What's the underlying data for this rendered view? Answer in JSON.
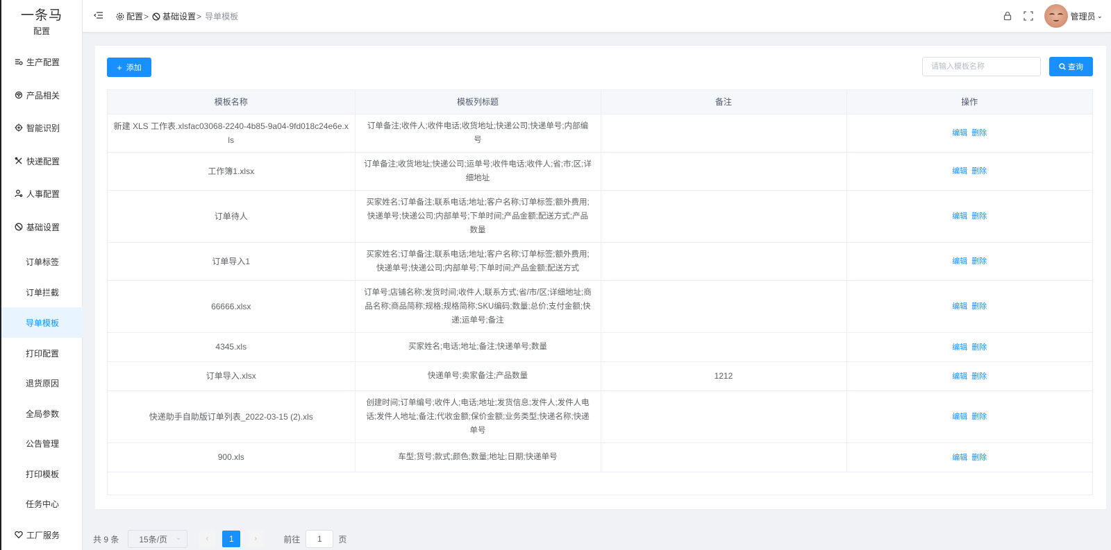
{
  "app": {
    "logo_main": "一条马",
    "logo_sub": "配置"
  },
  "sidebar": {
    "items": [
      {
        "label": "生产配置",
        "icon": "sliders-icon"
      },
      {
        "label": "产品相关",
        "icon": "box-icon"
      },
      {
        "label": "智能识别",
        "icon": "target-icon"
      },
      {
        "label": "快递配置",
        "icon": "tools-icon"
      },
      {
        "label": "人事配置",
        "icon": "user-gear-icon"
      },
      {
        "label": "基础设置",
        "icon": "clock-icon"
      }
    ],
    "sub_items": [
      {
        "label": "订单标签"
      },
      {
        "label": "订单拦截"
      },
      {
        "label": "导单模板"
      },
      {
        "label": "打印配置"
      },
      {
        "label": "退货原因"
      },
      {
        "label": "全局参数"
      },
      {
        "label": "公告管理"
      },
      {
        "label": "打印模板"
      },
      {
        "label": "任务中心"
      }
    ],
    "active_sub": "导单模板",
    "factory": {
      "label": "工厂服务",
      "icon": "heart-icon"
    }
  },
  "header": {
    "breadcrumb": [
      "配置",
      "基础设置",
      "导单模板"
    ],
    "separator": ">",
    "username": "管理员"
  },
  "toolbar": {
    "add_label": "添加",
    "search_placeholder": "请输入模板名称",
    "query_label": "查询"
  },
  "table": {
    "columns": [
      "模板名称",
      "模板列标题",
      "备注",
      "操作"
    ],
    "edit_label": "编辑",
    "delete_label": "删除",
    "rows": [
      {
        "name": "新建 XLS 工作表.xlsfac03068-2240-4b85-9a04-9fd018c24e6e.xls",
        "titles": "订单备注;收件人;收件电话;收货地址;快递公司;快递单号;内部编号",
        "remark": ""
      },
      {
        "name": "工作簿1.xlsx",
        "titles": "订单备注;收货地址;快递公司;运单号;收件电话;收件人;省;市;区;详细地址",
        "remark": ""
      },
      {
        "name": "订单待人",
        "titles": "买家姓名;订单备注;联系电话;地址;客户名称;订单标签;额外费用;快递单号;快递公司;内部单号;下单时间;产品金额;配送方式;产品数量",
        "remark": ""
      },
      {
        "name": "订单导入1",
        "titles": "买家姓名;订单备注;联系电话;地址;客户名称;订单标签;额外费用;快递单号;快递公司;内部单号;下单时间;产品金额;配送方式",
        "remark": ""
      },
      {
        "name": "66666.xlsx",
        "titles": "订单号;店铺名称;发货时间;收件人;联系方式;省/市/区;详细地址;商品名称;商品简称;规格;规格简称;SKU编码;数量;总价;支付金额;快递;运单号;备注",
        "remark": ""
      },
      {
        "name": "4345.xls",
        "titles": "买家姓名;电话;地址;备注;快递单号;数量",
        "remark": ""
      },
      {
        "name": "订单导入.xlsx",
        "titles": "快递单号;卖家备注;产品数量",
        "remark": "1212"
      },
      {
        "name": "快递助手自助版订单列表_2022-03-15 (2).xls",
        "titles": "创建时间;订单编号;收件人;电话;地址;发货信息;发件人;发件人电话;发件人地址;备注;代收金额;保价金额;业务类型;快递名称;快递单号",
        "remark": ""
      },
      {
        "name": "900.xls",
        "titles": "车型;货号;款式;颜色;数量;地址;日期;快递单号",
        "remark": ""
      }
    ]
  },
  "pagination": {
    "total_text": "共 9 条",
    "page_size": "15条/页",
    "current_page": "1",
    "goto_label": "前往",
    "goto_value": "1",
    "page_suffix": "页"
  },
  "colors": {
    "primary": "#1890ff",
    "active_bg": "#e8f4ff"
  }
}
